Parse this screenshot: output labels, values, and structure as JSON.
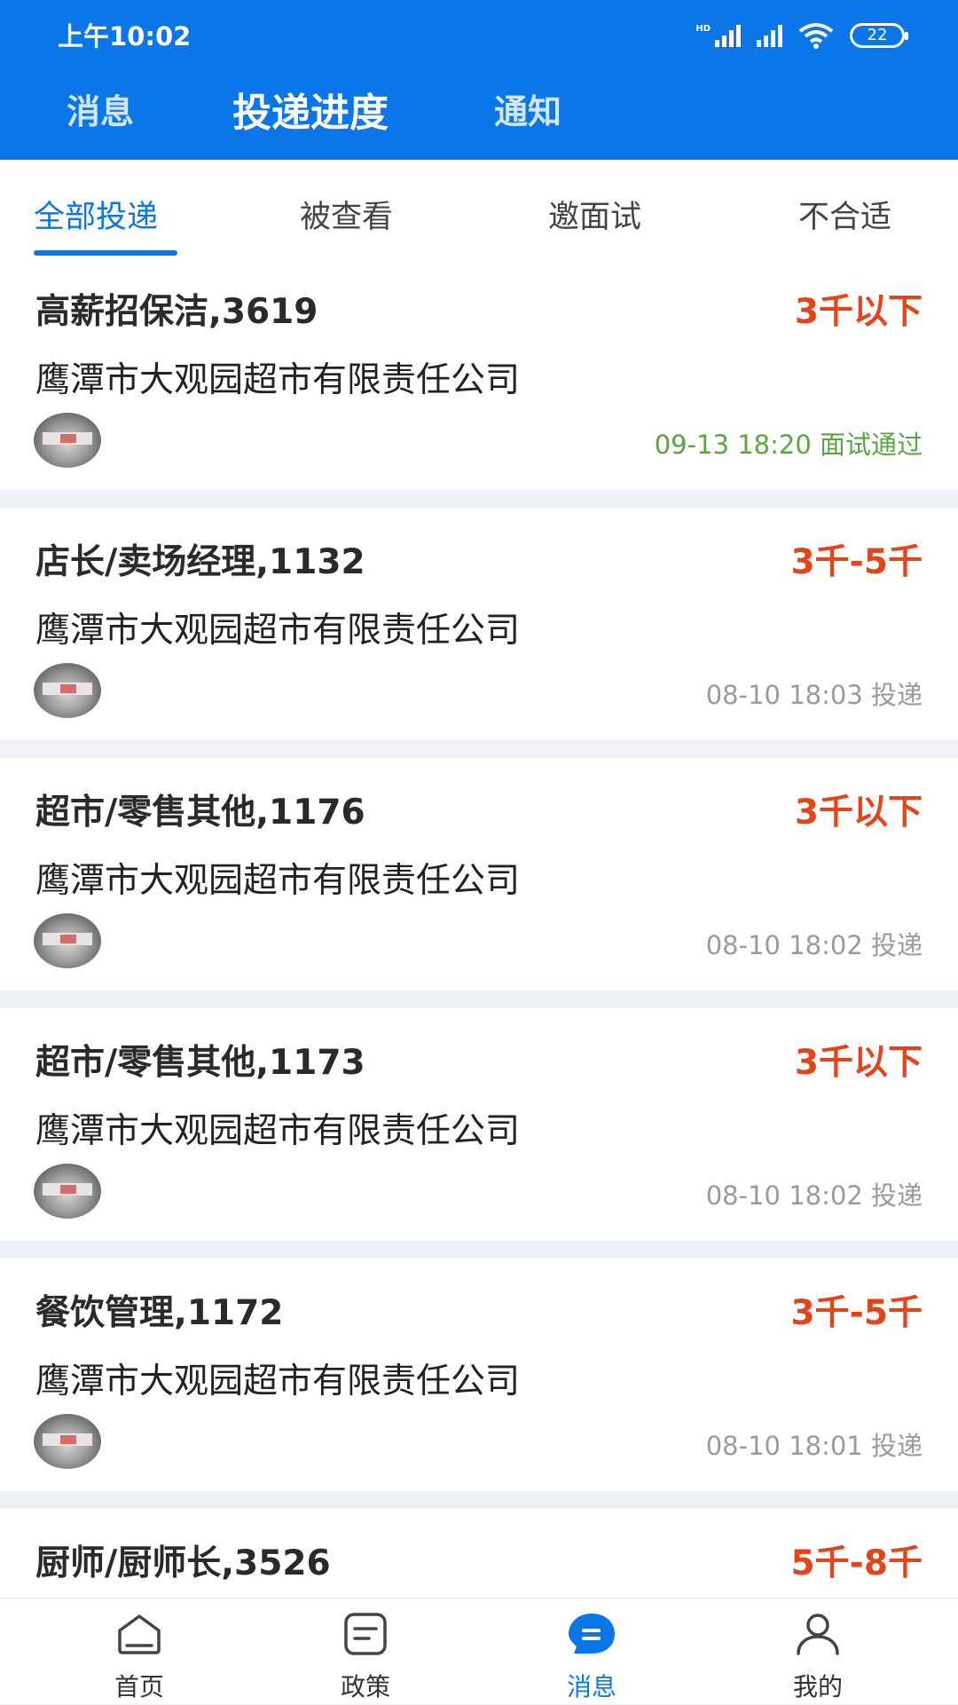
{
  "status_bar": {
    "time": "上午10:02",
    "network_label": "HD",
    "battery": "22"
  },
  "top_tabs": [
    {
      "label": "消息",
      "active": false
    },
    {
      "label": "投递进度",
      "active": true
    },
    {
      "label": "通知",
      "active": false
    }
  ],
  "sub_tabs": [
    {
      "label": "全部投递",
      "active": true
    },
    {
      "label": "被查看",
      "active": false
    },
    {
      "label": "邀面试",
      "active": false
    },
    {
      "label": "不合适",
      "active": false
    }
  ],
  "applications": [
    {
      "title": "高薪招保洁,3619",
      "salary": "3千以下",
      "company": "鹰潭市大观园超市有限责任公司",
      "status": "09-13 18:20 面试通过"
    },
    {
      "title": "店长/卖场经理,1132",
      "salary": "3千-5千",
      "company": "鹰潭市大观园超市有限责任公司",
      "status": "08-10 18:03 投递"
    },
    {
      "title": "超市/零售其他,1176",
      "salary": "3千以下",
      "company": "鹰潭市大观园超市有限责任公司",
      "status": "08-10 18:02 投递"
    },
    {
      "title": "超市/零售其他,1173",
      "salary": "3千以下",
      "company": "鹰潭市大观园超市有限责任公司",
      "status": "08-10 18:02 投递"
    },
    {
      "title": "餐饮管理,1172",
      "salary": "3千-5千",
      "company": "鹰潭市大观园超市有限责任公司",
      "status": "08-10 18:01 投递"
    },
    {
      "title": "厨师/厨师长,3526",
      "salary": "5千-8千"
    }
  ],
  "bottom_nav": [
    {
      "label": "首页",
      "icon": "home-icon",
      "active": false
    },
    {
      "label": "政策",
      "icon": "policy-icon",
      "active": false
    },
    {
      "label": "消息",
      "icon": "message-icon",
      "active": true
    },
    {
      "label": "我的",
      "icon": "profile-icon",
      "active": false
    }
  ],
  "colors": {
    "primary": "#0a76e8",
    "salary": "#e5431a",
    "status_pass": "#58a641",
    "status_default": "#9a9a9a"
  }
}
